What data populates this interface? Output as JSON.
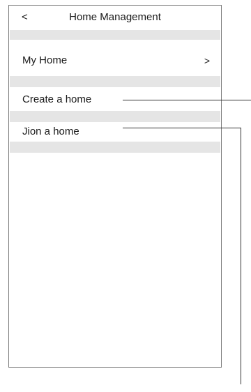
{
  "header": {
    "title": "Home Management",
    "back_glyph": "<",
    "back_icon_name": "back-chevron-icon"
  },
  "menu": {
    "items": [
      {
        "label": "My Home",
        "chevron": ">"
      },
      {
        "label": "Create a home"
      },
      {
        "label": "Jion a home"
      }
    ]
  },
  "colors": {
    "separator": "#e5e5e5",
    "border": "#7a7a7a",
    "callout": "#333333"
  }
}
